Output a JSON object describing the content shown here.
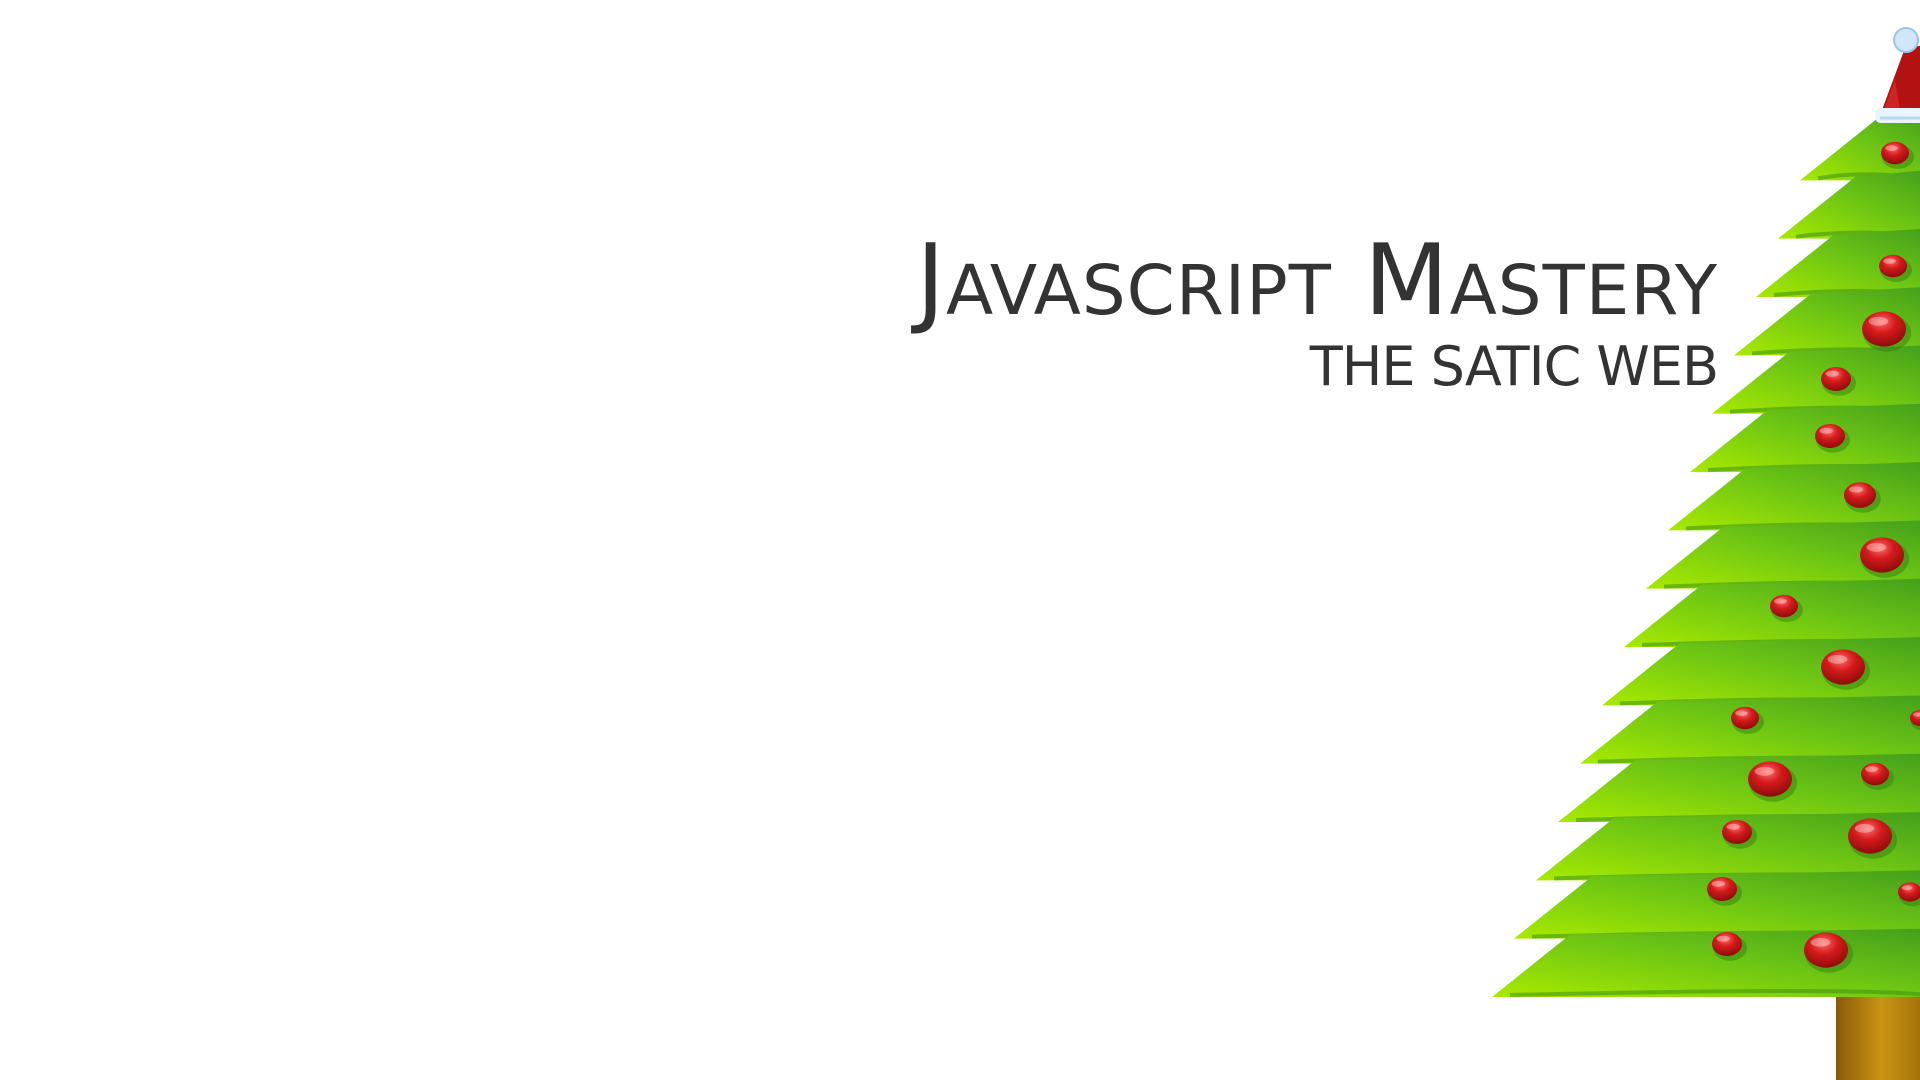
{
  "title": {
    "main": "Javascript Mastery",
    "sub": "THE SATIC WEB"
  },
  "artwork": {
    "name": "christmas-tree-illustration",
    "colors": {
      "tree_light": "#9ee600",
      "tree_dark": "#4aa41b",
      "ornament": "#c8141a",
      "ornament_highlight": "#ff5a5a",
      "hat_red": "#b31212",
      "hat_trim": "#e8f4ff",
      "trunk": "#b9860f"
    }
  }
}
